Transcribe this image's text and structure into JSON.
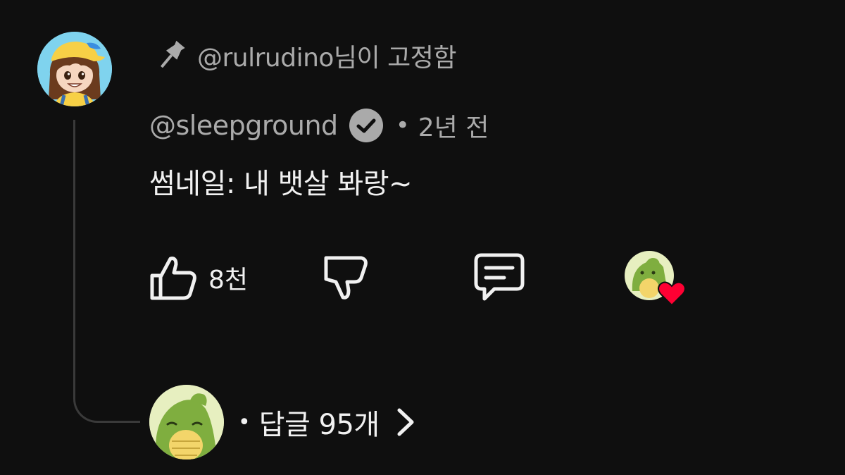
{
  "pinned": {
    "label": "@rulrudino님이 고정함",
    "icon": "pin-icon"
  },
  "comment": {
    "author": "@sleepground",
    "verified_icon": "verified-check-icon",
    "separator": "•",
    "timestamp": "2년 전",
    "text": "썸네일: 내 뱃살 봐랑~"
  },
  "actions": {
    "like_icon": "thumbs-up-icon",
    "like_count": "8천",
    "dislike_icon": "thumbs-down-icon",
    "reply_icon": "comment-icon",
    "creator_heart_icon": "creator-heart-icon"
  },
  "replies": {
    "separator": "•",
    "label": "답글 95개",
    "chevron_icon": "chevron-right-icon"
  },
  "colors": {
    "background": "#0f0f0f",
    "secondary_text": "#aaaaaa",
    "primary_text": "#f1f1f1",
    "heart": "#ff0033"
  }
}
